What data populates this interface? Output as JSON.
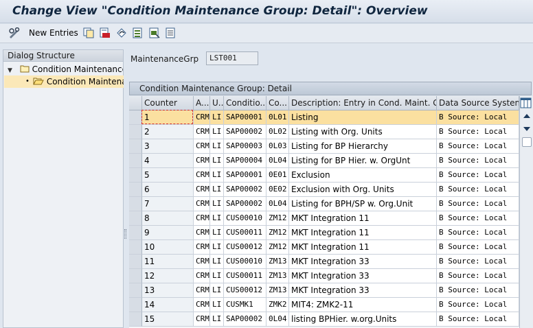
{
  "window": {
    "title": "Change View \"Condition Maintenance Group: Detail\": Overview"
  },
  "toolbar": {
    "new_entries_label": "New Entries"
  },
  "dialog_structure": {
    "header": "Dialog Structure",
    "items": [
      {
        "label": "Condition Maintenance G"
      },
      {
        "label": "Condition Maintenan"
      }
    ]
  },
  "maintenance_group": {
    "label": "MaintenanceGrp",
    "value": "LST001"
  },
  "table": {
    "caption": "Condition Maintenance Group: Detail",
    "columns": [
      "Counter",
      "A...",
      "U...",
      "Conditio...",
      "Co...",
      "Description: Entry in Cond. Maint. G...",
      "Data Source System"
    ],
    "rows": [
      [
        "1",
        "CRM",
        "LI",
        "SAP00001",
        "0L01",
        "Listing",
        "B Source: Local"
      ],
      [
        "2",
        "CRM",
        "LI",
        "SAP00002",
        "0L02",
        "Listing with Org. Units",
        "B Source: Local"
      ],
      [
        "3",
        "CRM",
        "LI",
        "SAP00003",
        "0L03",
        "Listing for BP Hierarchy",
        "B Source: Local"
      ],
      [
        "4",
        "CRM",
        "LI",
        "SAP00004",
        "0L04",
        "Listing for BP Hier. w. OrgUnt",
        "B Source: Local"
      ],
      [
        "5",
        "CRM",
        "LI",
        "SAP00001",
        "0E01",
        "Exclusion",
        "B Source: Local"
      ],
      [
        "6",
        "CRM",
        "LI",
        "SAP00002",
        "0E02",
        "Exclusion with Org. Units",
        "B Source: Local"
      ],
      [
        "7",
        "CRM",
        "LI",
        "SAP00002",
        "0L04",
        "Listing for BPH/SP w. Org.Unit",
        "B Source: Local"
      ],
      [
        "8",
        "CRM",
        "LI",
        "CUS00010",
        "ZM12",
        "MKT Integration 11",
        "B Source: Local"
      ],
      [
        "9",
        "CRM",
        "LI",
        "CUS00011",
        "ZM12",
        "MKT Integration 11",
        "B Source: Local"
      ],
      [
        "10",
        "CRM",
        "LI",
        "CUS00012",
        "ZM12",
        "MKT Integration 11",
        "B Source: Local"
      ],
      [
        "11",
        "CRM",
        "LI",
        "CUS00010",
        "ZM13",
        "MKT Integration  33",
        "B Source: Local"
      ],
      [
        "12",
        "CRM",
        "LI",
        "CUS00011",
        "ZM13",
        "MKT Integration  33",
        "B Source: Local"
      ],
      [
        "13",
        "CRM",
        "LI",
        "CUS00012",
        "ZM13",
        "MKT Integration  33",
        "B Source: Local"
      ],
      [
        "14",
        "CRM",
        "LI",
        "CUSMK1",
        "ZMK2",
        "MIT4: ZMK2-11",
        "B Source: Local"
      ],
      [
        "15",
        "CRM",
        "LI",
        "SAP00002",
        "0L04",
        "listing BPHier. w.org.Units",
        "B Source: Local"
      ]
    ]
  },
  "colors": {
    "selection": "#fbe0a0",
    "title_text": "#10263f"
  }
}
